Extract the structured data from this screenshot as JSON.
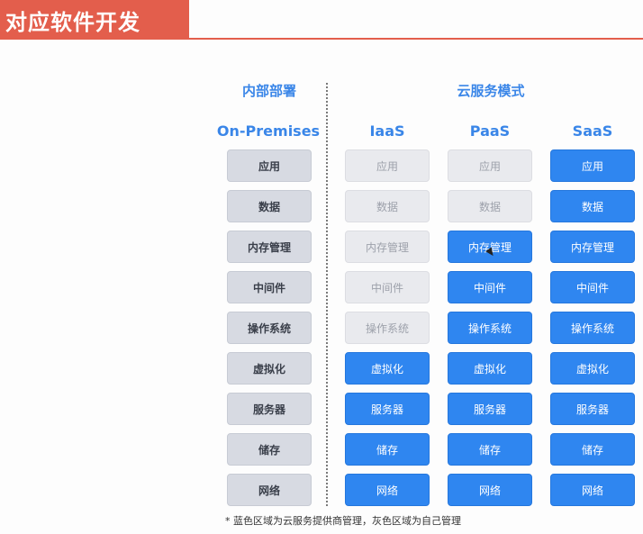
{
  "banner_title": "对应软件开发",
  "group_headers": {
    "on_prem": "内部部署",
    "cloud": "云服务模式"
  },
  "columns": [
    {
      "name": "On-Premises",
      "cells": [
        "应用",
        "数据",
        "内存管理",
        "中间件",
        "操作系统",
        "虚拟化",
        "服务器",
        "储存",
        "网络"
      ],
      "styles": [
        "self",
        "self",
        "self",
        "self",
        "self",
        "self",
        "self",
        "self",
        "self"
      ]
    },
    {
      "name": "IaaS",
      "cells": [
        "应用",
        "数据",
        "内存管理",
        "中间件",
        "操作系统",
        "虚拟化",
        "服务器",
        "储存",
        "网络"
      ],
      "styles": [
        "light",
        "light",
        "light",
        "light",
        "light",
        "prov",
        "prov",
        "prov",
        "prov"
      ]
    },
    {
      "name": "PaaS",
      "cells": [
        "应用",
        "数据",
        "内存管理",
        "中间件",
        "操作系统",
        "虚拟化",
        "服务器",
        "储存",
        "网络"
      ],
      "styles": [
        "light",
        "light",
        "prov",
        "prov",
        "prov",
        "prov",
        "prov",
        "prov",
        "prov"
      ]
    },
    {
      "name": "SaaS",
      "cells": [
        "应用",
        "数据",
        "内存管理",
        "中间件",
        "操作系统",
        "虚拟化",
        "服务器",
        "储存",
        "网络"
      ],
      "styles": [
        "prov",
        "prov",
        "prov",
        "prov",
        "prov",
        "prov",
        "prov",
        "prov",
        "prov"
      ]
    }
  ],
  "footnote": "* 蓝色区域为云服务提供商管理，灰色区域为自己管理",
  "colors": {
    "banner": "#e35e4c",
    "accent": "#3a86e8",
    "provider_blue": "#2f86f0",
    "self_gray": "#d7dae2",
    "light_gray": "#e9eaee"
  }
}
